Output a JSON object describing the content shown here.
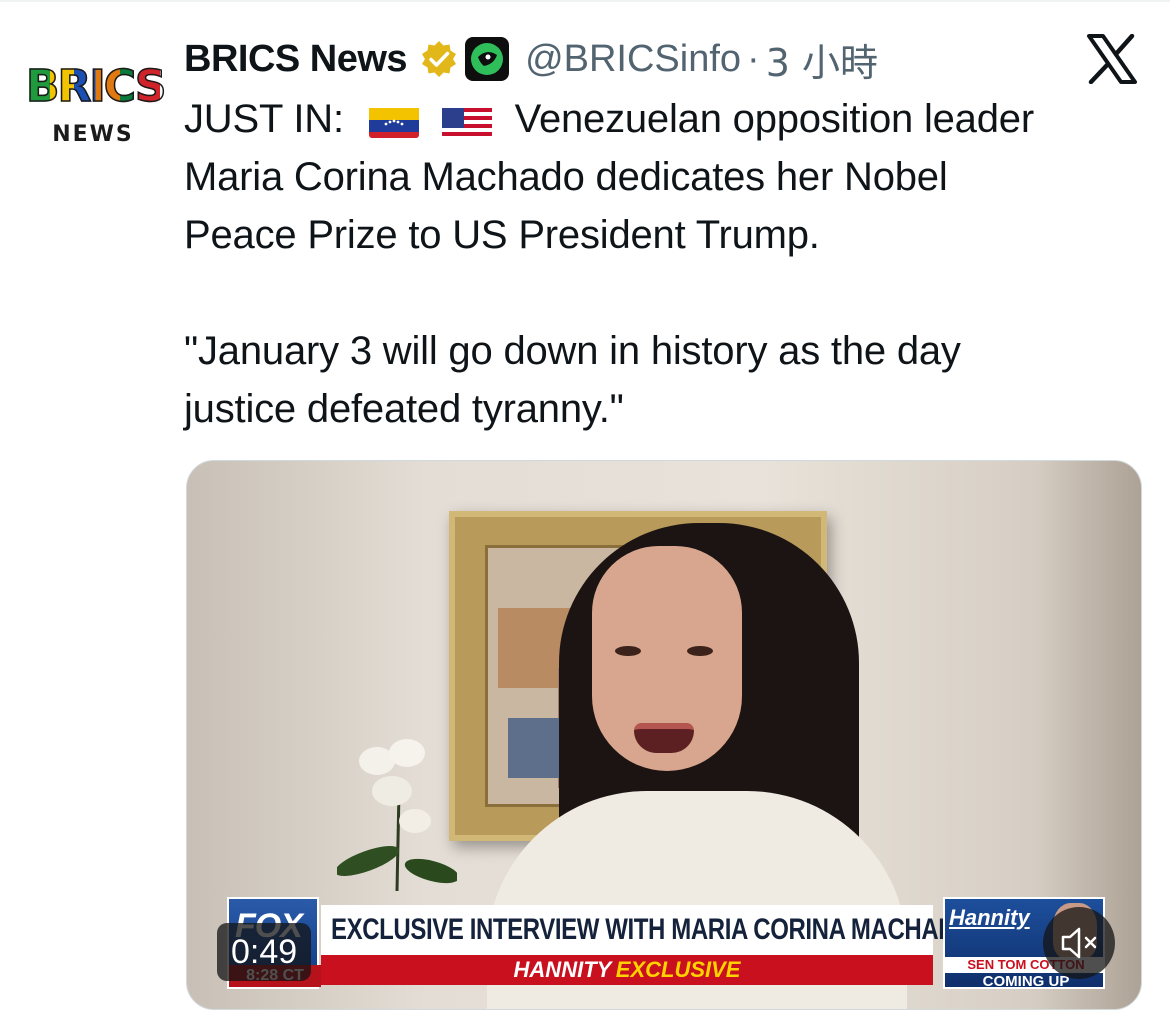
{
  "author": {
    "avatar_logo_text": "BRICS",
    "avatar_logo_subtext": "NEWS",
    "display_name": "BRICS News",
    "handle": "@BRICSinfo",
    "separator": "·",
    "time": "3 小時"
  },
  "tweet": {
    "line1_prefix": "JUST IN:",
    "line1_suffix": "Venezuelan opposition leader",
    "line2": "Maria Corina Machado dedicates her Nobel",
    "line3": "Peace Prize to US President Trump.",
    "quote_line1": "\"January 3 will go down in history as the day",
    "quote_line2": "justice defeated tyranny.\""
  },
  "video": {
    "duration": "0:49",
    "broadcast": {
      "network": "FOX",
      "clock": "8:28 CT",
      "headline": "EXCLUSIVE INTERVIEW WITH MARIA CORINA MACHADO",
      "sub_show": "HANNITY",
      "sub_tag": "EXCLUSIVE",
      "show_logo": "Hannity",
      "upnext_name": "SEN TOM COTTON",
      "upnext_label": "COMING UP"
    }
  },
  "colors": {
    "text_primary": "#0f1419",
    "text_secondary": "#536471",
    "verified_gold": "#e2b719",
    "fox_red": "#c8101e",
    "fox_blue": "#0e3a86"
  },
  "icons": {
    "verified": "verified-badge-gold",
    "affiliate": "affiliate-badge",
    "platform": "x-logo",
    "mute": "speaker-muted",
    "flag1": "venezuela-flag",
    "flag2": "usa-flag"
  }
}
